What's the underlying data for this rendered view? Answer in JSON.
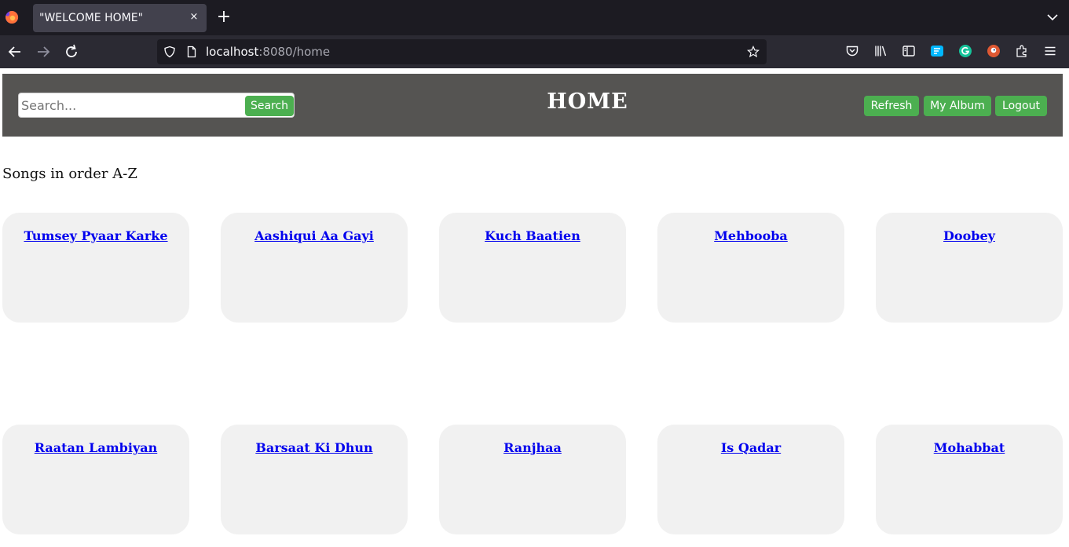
{
  "browser": {
    "tab_title": "\"WELCOME HOME\"",
    "tab_close": "×",
    "new_tab": "+",
    "url_host": "localhost",
    "url_rest": ":8080/home"
  },
  "header": {
    "search_placeholder": "Search...",
    "search_button": "Search",
    "title": "HOME",
    "refresh_button": "Refresh",
    "album_button": "My Album",
    "logout_button": "Logout"
  },
  "songs_label": "Songs in order A-Z",
  "songs": [
    "Tumsey Pyaar Karke",
    "Aashiqui Aa Gayi",
    "Kuch Baatien",
    "Mehbooba",
    "Doobey",
    "Raatan Lambiyan",
    "Barsaat Ki Dhun",
    "Ranjhaa",
    "Is Qadar",
    "Mohabbat"
  ],
  "colors": {
    "header_bg": "#555452",
    "button_green": "#4caf50",
    "card_bg": "#f1f1f1",
    "link_blue": "#0000ee"
  }
}
